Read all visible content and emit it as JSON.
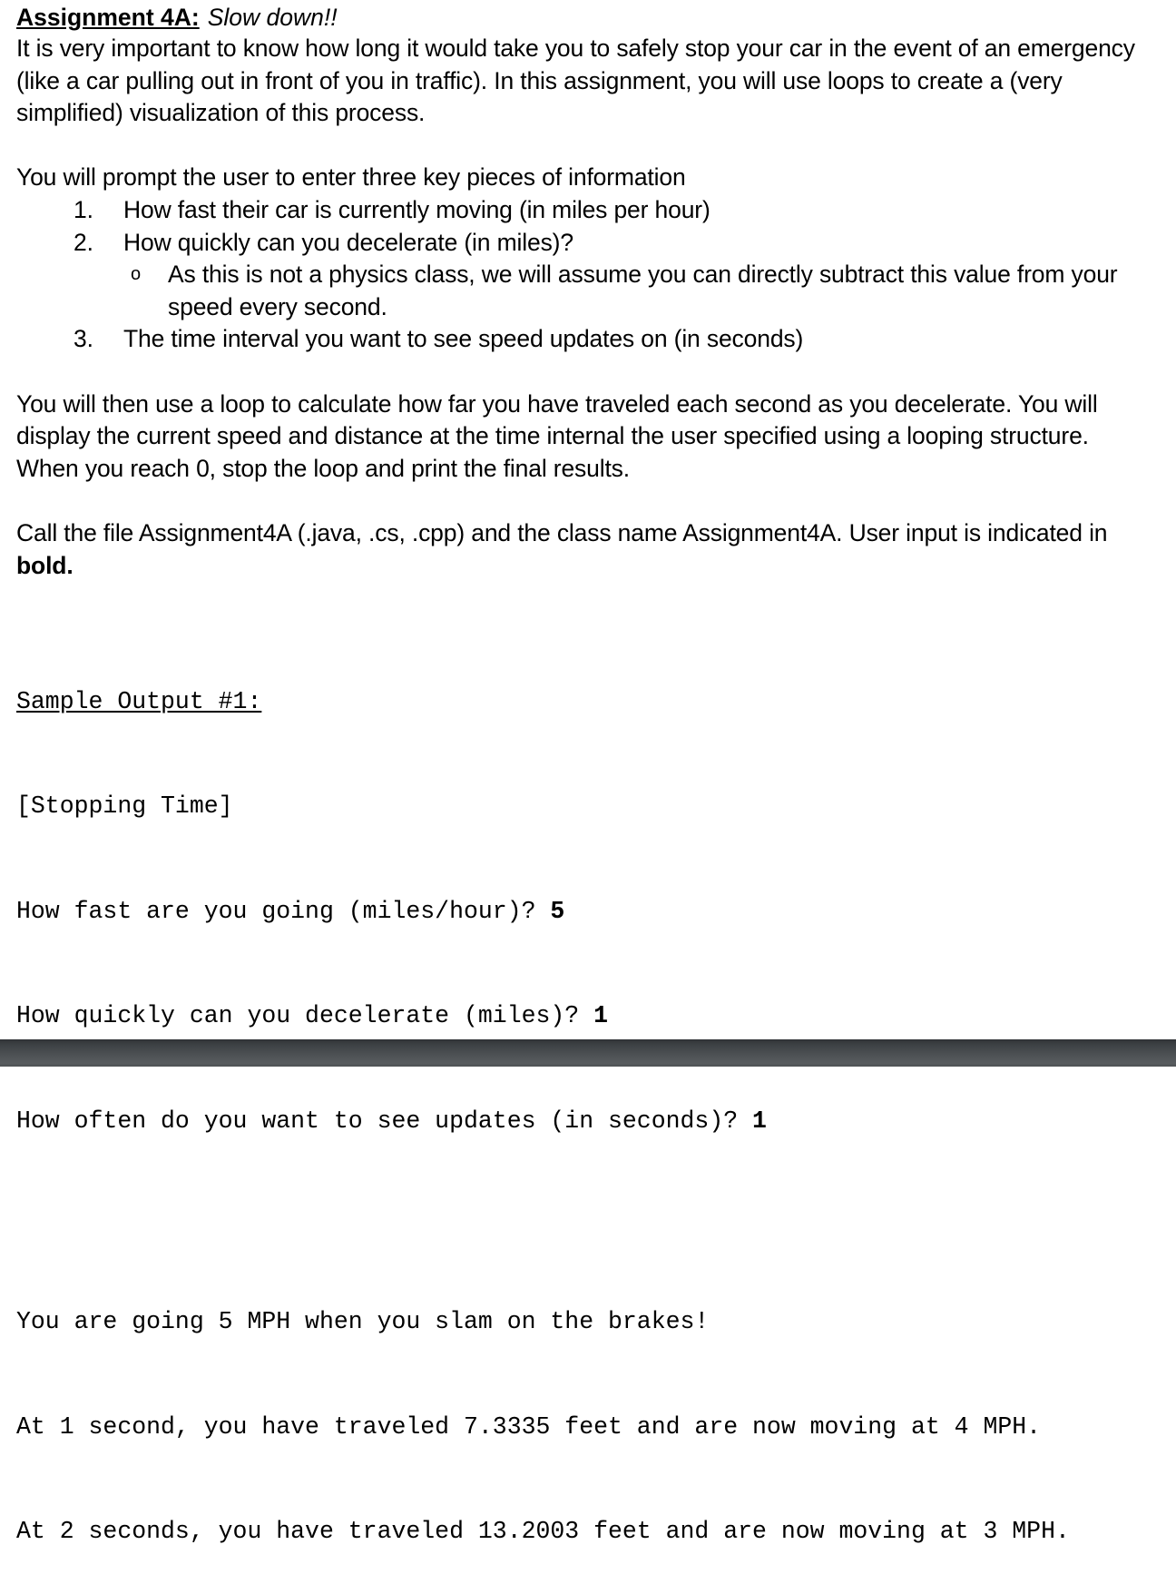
{
  "document": {
    "title_label": "Assignment 4A:",
    "title_subtitle": "Slow down!!",
    "intro_paragraph": "It is very important to know how long it would take you to safely stop your car in the event of an emergency (like a car pulling out in front of you in traffic). In this assignment, you will use loops to create a (very simplified) visualization of this process.",
    "prompt_intro": "You will prompt the user to enter three key pieces of information",
    "requirements": [
      {
        "marker": "1.",
        "text": "How fast their car is currently moving (in miles per hour)"
      },
      {
        "marker": "2.",
        "text": "How quickly can you decelerate (in miles)?",
        "sub_marker": "o",
        "sub_text": "As this is not a physics class, we will assume you can directly subtract this value from your speed every second."
      },
      {
        "marker": "3.",
        "text": "The time interval you want to see speed updates on (in seconds)"
      }
    ],
    "loop_paragraph": "You will then use a loop to calculate how far you have traveled each second as you decelerate. You will display the current speed and distance at the time internal the user specified using a looping structure. When you reach 0, stop the loop and print the final results.",
    "file_paragraph_prefix": "Call the file Assignment4A (.java, .cs, .cpp) and the class name Assignment4A. User input is indicated in ",
    "file_paragraph_bold": "bold."
  },
  "sample_output": {
    "heading": "Sample Output #1:",
    "program_title": "[Stopping Time]",
    "prompts": [
      {
        "text": "How fast are you going (miles/hour)? ",
        "input": "5"
      },
      {
        "text": "How quickly can you decelerate (miles)? ",
        "input": "1"
      },
      {
        "text": "How often do you want to see updates (in seconds)? ",
        "input": "1"
      }
    ]
  },
  "console_continuation": {
    "lines": [
      "You are going 5 MPH when you slam on the brakes!",
      "At 1 second, you have traveled 7.3335 feet and are now moving at 4 MPH.",
      "At 2 seconds, you have traveled 13.2003 feet and are now moving at 3 MPH."
    ]
  },
  "page_break": {
    "color_top": "#303336",
    "color_bottom": "#585c5f"
  }
}
